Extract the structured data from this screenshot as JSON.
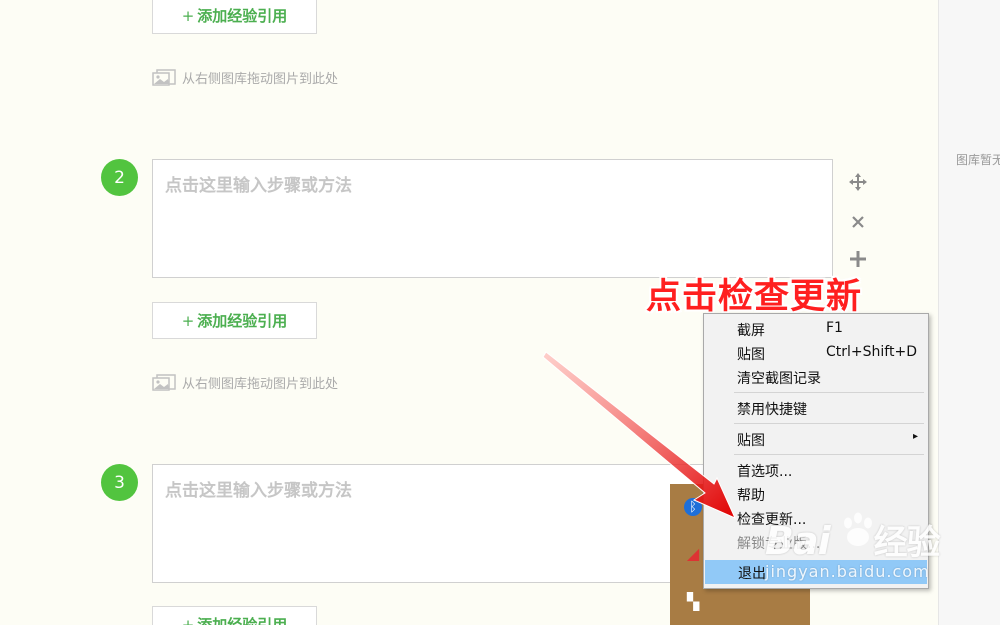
{
  "editor": {
    "add_reference_label": "添加经验引用",
    "add_reference_plus": "+",
    "drag_hint": "从右侧图库拖动图片到此处",
    "step_placeholder": "点击这里输入步骤或方法",
    "steps": [
      {
        "number": "2"
      },
      {
        "number": "3"
      }
    ]
  },
  "gallery": {
    "empty_text": "图库暂无图片"
  },
  "annotation": {
    "text": "点击检查更新",
    "color": "#ff1f1f"
  },
  "context_menu": {
    "items": [
      {
        "label": "截屏",
        "shortcut": "F1"
      },
      {
        "label": "贴图",
        "shortcut": "Ctrl+Shift+D"
      },
      {
        "label": "清空截图记录"
      },
      {
        "label": "禁用快捷键"
      },
      {
        "label": "贴图",
        "submenu": "▸"
      },
      {
        "label": "首选项..."
      },
      {
        "label": "帮助"
      },
      {
        "label": "检查更新..."
      },
      {
        "label": "解锁专业版...",
        "disabled": true
      },
      {
        "label": "退出",
        "highlighted": true
      }
    ]
  },
  "tray": {
    "icons": [
      "bluetooth-icon",
      "network-icon",
      "app-icon"
    ],
    "background": "#a87c44"
  },
  "watermark": {
    "brand_left": "Bai",
    "brand_right": "经验",
    "url": "jingyan.baidu.com"
  },
  "theme": {
    "step_badge": "#52c43f",
    "accent_green": "#4caf50",
    "menu_highlight": "#91c9f7"
  }
}
